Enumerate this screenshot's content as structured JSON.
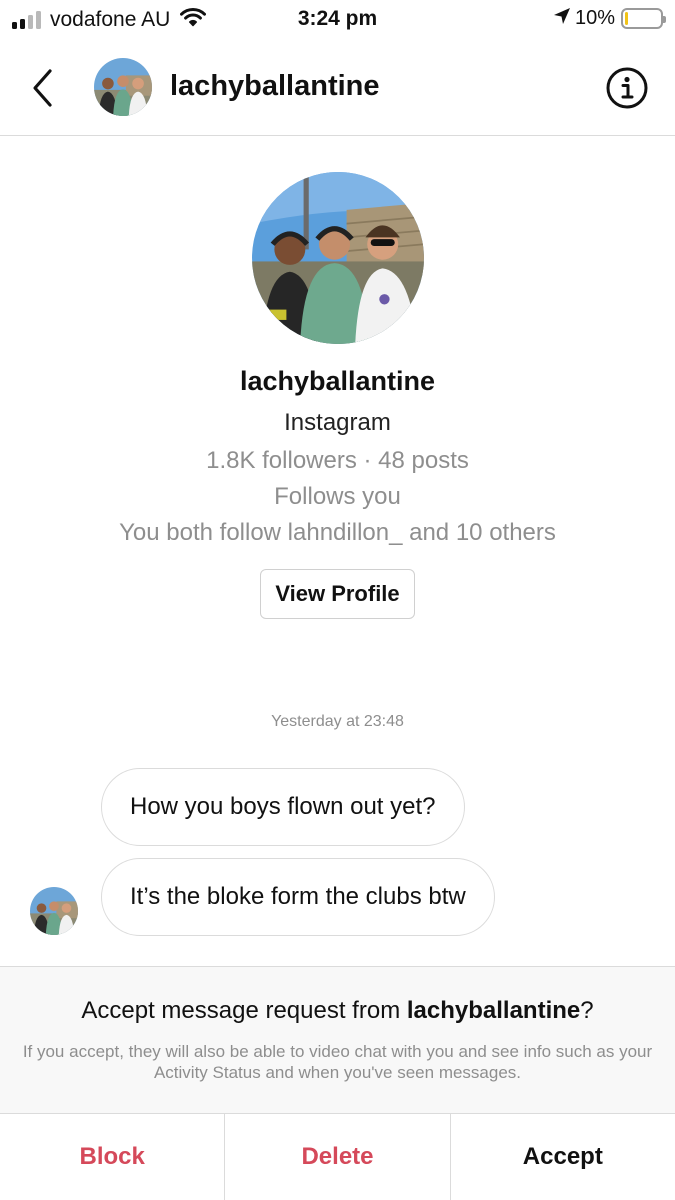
{
  "status_bar": {
    "carrier": "vodafone AU",
    "time": "3:24 pm",
    "battery_percent": "10%",
    "battery_level": 0.1,
    "signal_bars": 2,
    "icons": [
      "signal-icon",
      "wifi-icon",
      "location-arrow-icon",
      "battery-icon"
    ]
  },
  "header": {
    "username": "lachyballantine",
    "back_icon": "chevron-left-icon",
    "info_icon": "info-icon"
  },
  "profile": {
    "username": "lachyballantine",
    "subtitle": "Instagram",
    "stats": "1.8K followers · 48 posts",
    "follows_status": "Follows you",
    "mutual": "You both follow lahndillon_ and 10 others",
    "view_profile_label": "View Profile"
  },
  "conversation": {
    "timestamp": "Yesterday at 23:48",
    "messages": [
      {
        "text": "How you boys flown out yet?"
      },
      {
        "text": "It’s the bloke form the clubs btw"
      }
    ]
  },
  "request": {
    "title_prefix": "Accept message request from ",
    "title_username": "lachyballantine",
    "title_suffix": "?",
    "description": "If you accept, they will also be able to video chat with you and see info such as your Activity Status and when you've seen messages."
  },
  "actions": {
    "block_label": "Block",
    "delete_label": "Delete",
    "accept_label": "Accept"
  },
  "colors": {
    "danger": "#d5495a",
    "muted_text": "#8e8e8e",
    "divider": "#dbdbdb",
    "battery_fill": "#f2c318"
  }
}
